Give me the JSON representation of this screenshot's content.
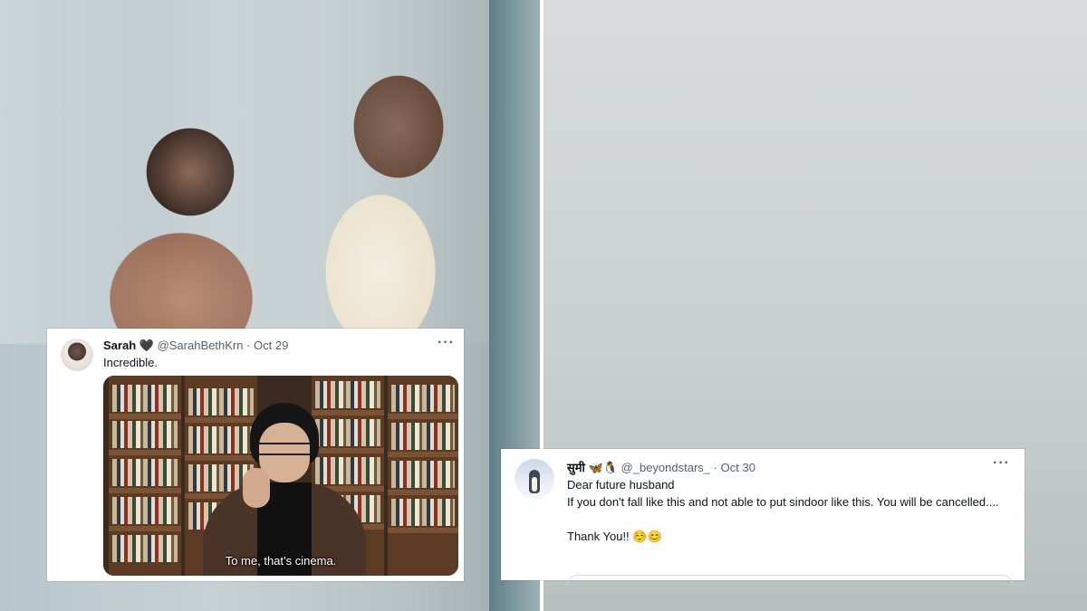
{
  "tweet_left": {
    "display_name": "Sarah 🖤",
    "handle": "@SarahBethKrn",
    "separator": "·",
    "date": "Oct 29",
    "more_icon": "···",
    "text": "Incredible.",
    "media_caption": "To me, that’s cinema."
  },
  "tweet_right": {
    "display_name": "सुमी 🦋🐧",
    "handle": "@_beyondstars_",
    "separator": "·",
    "date": "Oct 30",
    "more_icon": "···",
    "text": "Dear future husband\nIf you don't fall like this and not able to put sindoor like this. You will be cancelled....\n\nThank You!! ☺️😊"
  }
}
